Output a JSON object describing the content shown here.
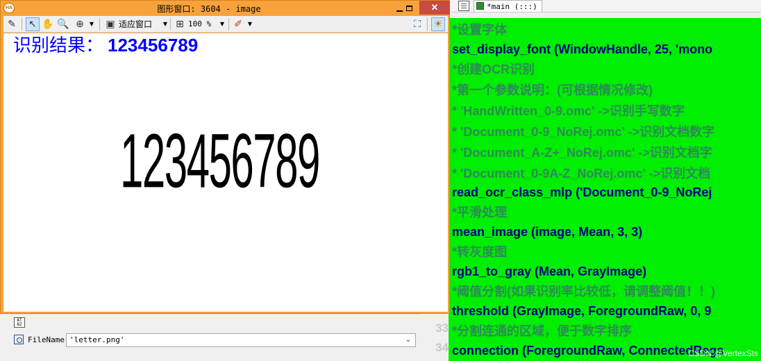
{
  "graphics_window": {
    "title": "图形窗口: 3604 - image",
    "app_icon_text": "HA",
    "toolbar": {
      "fit_window_label": "适应窗口",
      "zoom_value": "100 %"
    },
    "ocr_result": {
      "label": "识别结果：",
      "value": "123456789"
    },
    "image_text": "123456789"
  },
  "editor": {
    "tab_label": "*main (:::)",
    "lines": [
      {
        "text": "*设置字体",
        "kind": "comment"
      },
      {
        "text": "set_display_font (WindowHandle, 25, 'mono",
        "kind": "stmt"
      },
      {
        "text": "*创建OCR识别",
        "kind": "comment"
      },
      {
        "text": "*第一个参数说明：(可根据情况修改)",
        "kind": "comment"
      },
      {
        "text": "* 'HandWritten_0-9.omc'  ->识别手写数字",
        "kind": "comment"
      },
      {
        "text": "* 'Document_0-9_NoRej.omc'  ->识别文档数字",
        "kind": "comment"
      },
      {
        "text": "* 'Document_A-Z+_NoRej.omc'  ->识别文档字",
        "kind": "comment"
      },
      {
        "text": "* 'Document_0-9A-Z_NoRej.omc'  ->识别文档",
        "kind": "comment"
      },
      {
        "text": "read_ocr_class_mlp ('Document_0-9_NoRej",
        "kind": "stmt"
      },
      {
        "text": "*平滑处理",
        "kind": "comment"
      },
      {
        "text": "mean_image (image, Mean, 3, 3)",
        "kind": "stmt"
      },
      {
        "text": "*转灰度图",
        "kind": "comment"
      },
      {
        "text": "rgb1_to_gray (Mean, GrayImage)",
        "kind": "stmt"
      },
      {
        "text": "*阈值分割(如果识别率比较低，请调整阈值！！)",
        "kind": "comment"
      },
      {
        "text": "threshold (GrayImage, ForegroundRaw, 0, 9",
        "kind": "stmt"
      },
      {
        "text": "*分割连通的区域，便于数字排序",
        "kind": "comment"
      },
      {
        "text": "connection (ForegroundRaw, ConnectedRegs",
        "kind": "stmt"
      }
    ],
    "line_numbers": [
      "33",
      "34"
    ],
    "watermark": "CSDN @VertexSts"
  },
  "params": {
    "icon_text": "AT\nBZ",
    "file_label": "FileName",
    "file_value": "'letter.png'"
  }
}
